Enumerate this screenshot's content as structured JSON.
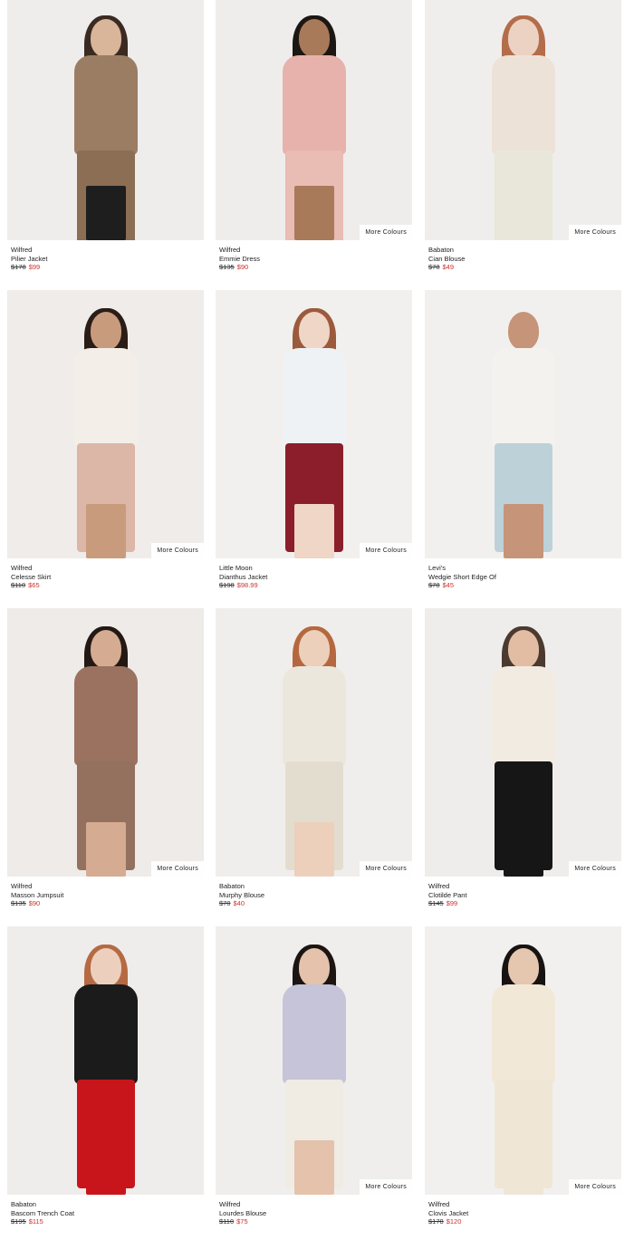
{
  "products": [
    {
      "brand": "Wilfred",
      "name": "Pilier Jacket",
      "was": "$178",
      "now": "$99",
      "more": "",
      "colors": {
        "bg": "#efedeb",
        "hair": "#3a2a22",
        "skin": "#d9b59a",
        "top": "#9b7d63",
        "bottom": "#8c6e55",
        "legs": "#1e1e1e"
      }
    },
    {
      "brand": "Wilfred",
      "name": "Emmie Dress",
      "was": "$135",
      "now": "$90",
      "more": "More Colours",
      "colors": {
        "bg": "#efedec",
        "hair": "#1d1713",
        "skin": "#a97a5a",
        "top": "#e6b2ab",
        "bottom": "#e9bcb4",
        "legs": "#a97a5a"
      }
    },
    {
      "brand": "Babaton",
      "name": "Cian Blouse",
      "was": "$78",
      "now": "$49",
      "more": "More Colours",
      "colors": {
        "bg": "#f0eeec",
        "hair": "#b36d4a",
        "skin": "#ecd2c3",
        "top": "#ede2d8",
        "bottom": "#e8e7da",
        "legs": "#e8e7da"
      }
    },
    {
      "brand": "Wilfred",
      "name": "Celesse Skirt",
      "was": "$110",
      "now": "$65",
      "more": "More Colours",
      "colors": {
        "bg": "#efecea",
        "hair": "#2a1d17",
        "skin": "#c99b7d",
        "top": "#f3efe8",
        "bottom": "#dcb6a6",
        "legs": "#c99b7d"
      }
    },
    {
      "brand": "Little Moon",
      "name": "Dianthus Jacket",
      "was": "$198",
      "now": "$98.99",
      "more": "More Colours",
      "colors": {
        "bg": "#f1f0ee",
        "hair": "#9b5a3c",
        "skin": "#efd6c6",
        "top": "#eef2f4",
        "bottom": "#8b1e2a",
        "legs": "#efd6c6"
      }
    },
    {
      "brand": "Levi's",
      "name": "Wedgie Short Edge Of",
      "was": "$78",
      "now": "$45",
      "more": "",
      "colors": {
        "bg": "#f2f0ee",
        "hair": "#f2f0ee",
        "skin": "#c69478",
        "top": "#f4f2ef",
        "bottom": "#bcd2d8",
        "legs": "#c69478"
      }
    },
    {
      "brand": "Wilfred",
      "name": "Masson Jumpsuit",
      "was": "$135",
      "now": "$90",
      "more": "More Colours",
      "colors": {
        "bg": "#eeebe8",
        "hair": "#231914",
        "skin": "#d5ab91",
        "top": "#9b7260",
        "bottom": "#94705f",
        "legs": "#d5ab91"
      }
    },
    {
      "brand": "Babaton",
      "name": "Murphy Blouse",
      "was": "$70",
      "now": "$40",
      "more": "More Colours",
      "colors": {
        "bg": "#f0eeec",
        "hair": "#b5683f",
        "skin": "#ecd0bc",
        "top": "#ece7dc",
        "bottom": "#e3ddd0",
        "legs": "#ecd0bc"
      }
    },
    {
      "brand": "Wilfred",
      "name": "Clotilde Pant",
      "was": "$145",
      "now": "$99",
      "more": "More Colours",
      "colors": {
        "bg": "#efedeb",
        "hair": "#4b3a30",
        "skin": "#e2bda4",
        "top": "#f1ebe2",
        "bottom": "#161616",
        "legs": "#161616"
      }
    },
    {
      "brand": "Babaton",
      "name": "Bascom Trench Coat",
      "was": "$195",
      "now": "$115",
      "more": "",
      "colors": {
        "bg": "#efedeb",
        "hair": "#b56a43",
        "skin": "#ecd0bd",
        "top": "#1b1b1b",
        "bottom": "#c8151b",
        "legs": "#c8151b"
      }
    },
    {
      "brand": "Wilfred",
      "name": "Lourdes Blouse",
      "was": "$110",
      "now": "$75",
      "more": "More Colours",
      "colors": {
        "bg": "#f0eeec",
        "hair": "#1c1512",
        "skin": "#e4c2ab",
        "top": "#c5c4d8",
        "bottom": "#f0ebe3",
        "legs": "#e4c2ab"
      }
    },
    {
      "brand": "Wilfred",
      "name": "Clovis Jacket",
      "was": "$178",
      "now": "$120",
      "more": "More Colours",
      "colors": {
        "bg": "#f1f0ee",
        "hair": "#171312",
        "skin": "#e5c6ae",
        "top": "#f1e8d8",
        "bottom": "#efe6d6",
        "legs": "#efe6d6"
      }
    }
  ]
}
